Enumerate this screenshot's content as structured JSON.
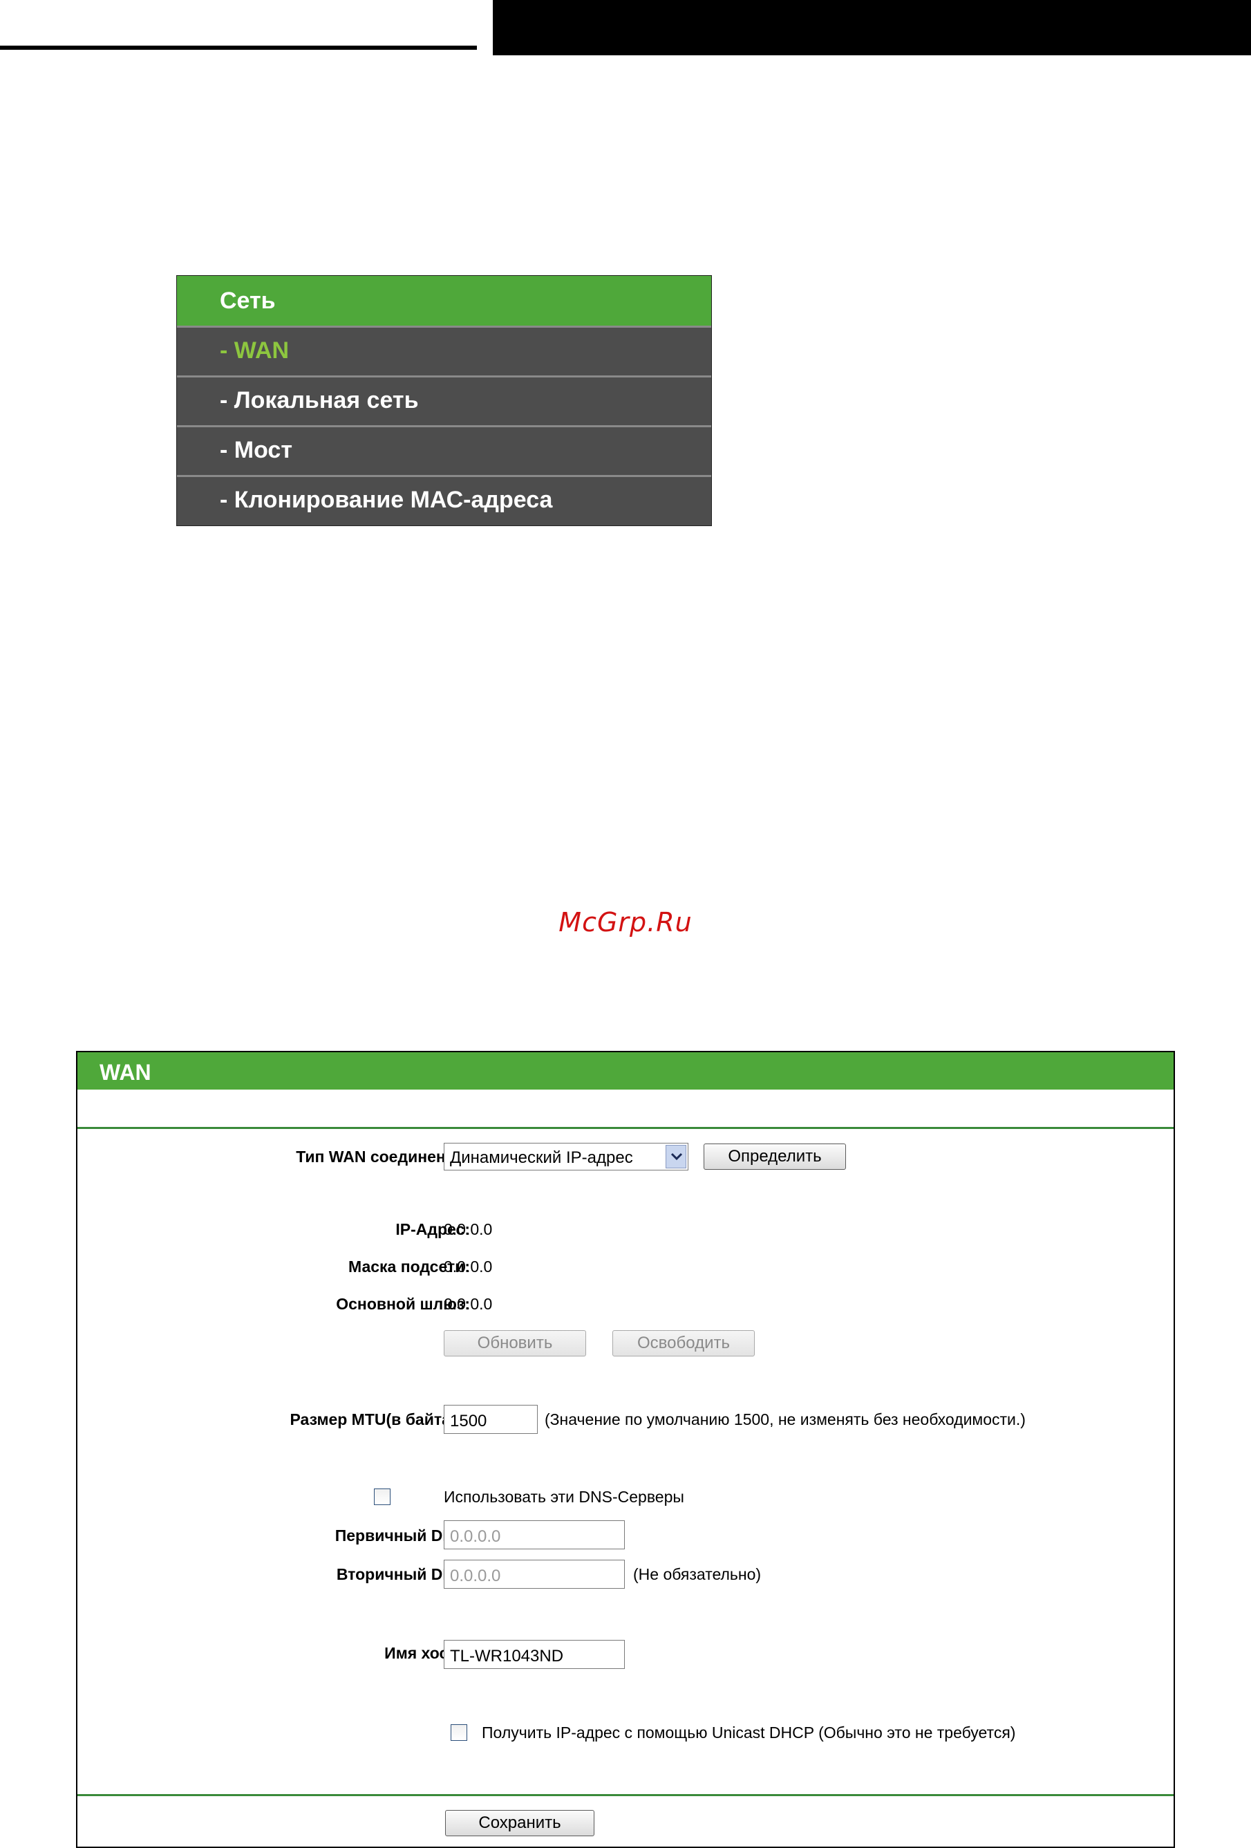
{
  "menu": {
    "title": "Сеть",
    "items": [
      "- WAN",
      "- Локальная сеть",
      "- Мост",
      "- Клонирование МАС-адреса"
    ],
    "active_index": 0
  },
  "watermark": "McGrp.Ru",
  "wan": {
    "title": "WAN",
    "connection_type_label": "Тип WAN соединения:",
    "connection_type_value": "Динамический IP-адрес",
    "detect_button": "Определить",
    "ip_label": "IP-Адрес:",
    "ip_value": "0.0.0.0",
    "mask_label": "Маска подсети:",
    "mask_value": "0.0.0.0",
    "gateway_label": "Основной шлюз:",
    "gateway_value": "0.0.0.0",
    "renew_button": "Обновить",
    "release_button": "Освободить",
    "mtu_label": "Размер MTU(в байтах):",
    "mtu_value": "1500",
    "mtu_note": "(Значение по умолчанию 1500, не изменять без необходимости.)",
    "use_dns_label": "Использовать эти DNS-Серверы",
    "use_dns_checked": false,
    "primary_dns_label": "Первичный DNS:",
    "primary_dns_value": "0.0.0.0",
    "secondary_dns_label": "Вторичный DNS:",
    "secondary_dns_value": "0.0.0.0",
    "secondary_dns_note": "(Не обязательно)",
    "hostname_label": "Имя хоста:",
    "hostname_value": "TL-WR1043ND",
    "unicast_label": "Получить IP-адрес с помощью Unicast DHCP (Обычно это не требуется)",
    "unicast_checked": false,
    "save_button": "Сохранить"
  },
  "colors": {
    "accent_green": "#4fa83a",
    "active_menu_text": "#8dc63f",
    "menu_bg": "#4d4d4d",
    "watermark": "#d31212"
  }
}
